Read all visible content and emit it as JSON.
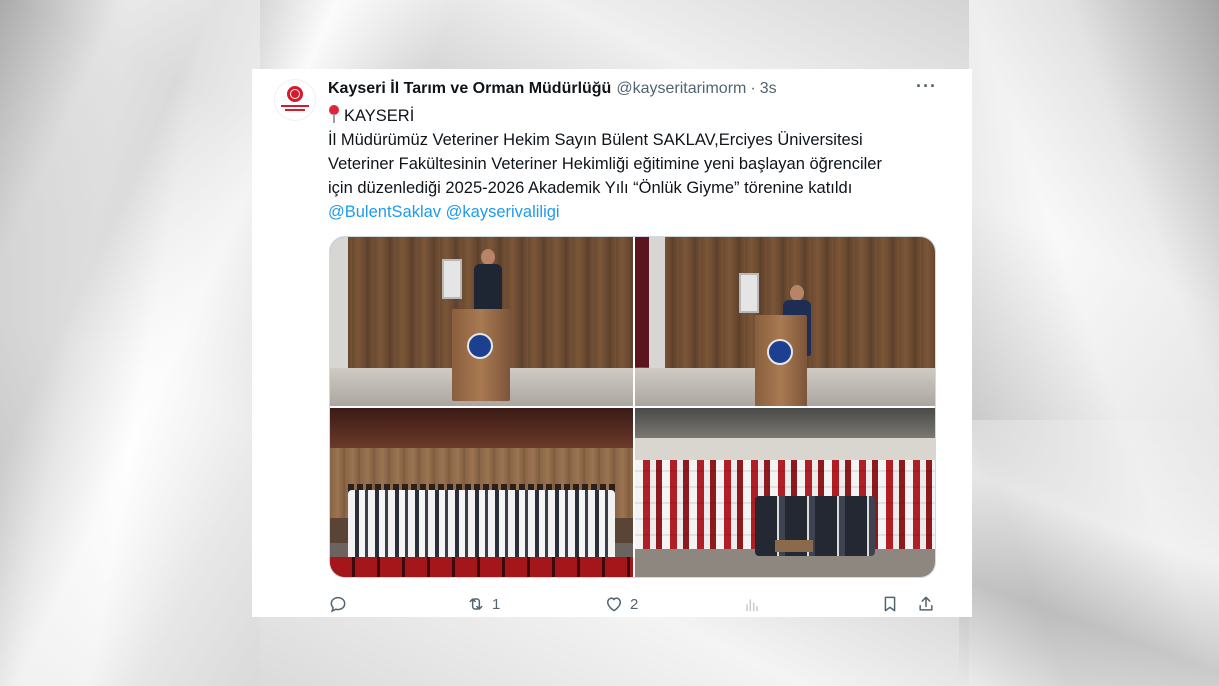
{
  "tweet": {
    "author_name": "Kayseri İl Tarım ve Orman Müdürlüğü",
    "handle": "@kayseritarimorm",
    "separator": "·",
    "time": "3s",
    "more_icon": "more-horizontal-icon",
    "location": "KAYSERİ",
    "text_line1": "İl Müdürümüz Veteriner Hekim Sayın Bülent SAKLAV,Erciyes Üniversitesi",
    "text_line2": "Veteriner Fakültesinin Veteriner Hekimliği eğitimine yeni başlayan öğrenciler",
    "text_line3": "için düzenlediği 2025-2026 Akademik Yılı “Önlük Giyme” törenine katıldı",
    "mention1": "@BulentSaklav",
    "mention2": "@kayserivaliligi",
    "media_count": 4,
    "actions": {
      "reply_count": "",
      "retweet_count": "1",
      "like_count": "2",
      "views_count": ""
    },
    "colors": {
      "link": "#1d9bf0",
      "text": "#0f1419",
      "muted": "#536471"
    }
  }
}
